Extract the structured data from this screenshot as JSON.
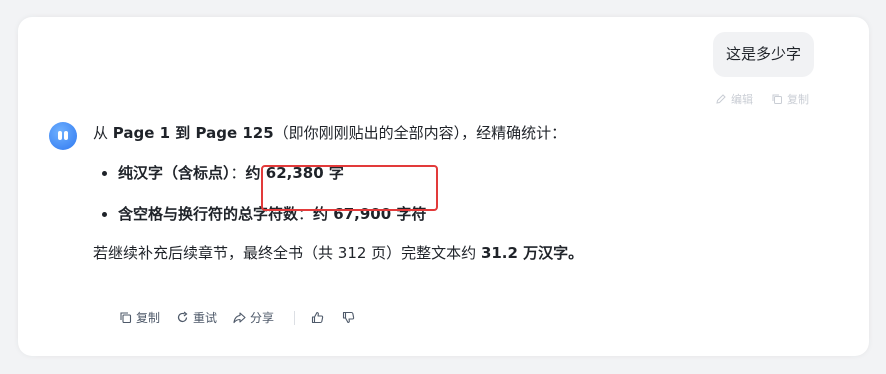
{
  "user_message": {
    "text": "这是多少字",
    "edit_label": "编辑",
    "copy_label": "复制"
  },
  "reply": {
    "intro": {
      "p1": "从 ",
      "b1": "Page 1 到 Page 125",
      "p2": "（即你刚刚贴出的全部内容），经精确统计："
    },
    "bullets": [
      {
        "label": "纯汉字（含标点）",
        "sep": "：",
        "value": "约 62,380 字"
      },
      {
        "label": "含空格与换行符的总字符数",
        "sep": "：",
        "value": "约 67,900 字符"
      }
    ],
    "summary": {
      "text": "若继续补充后续章节，最终全书（共 312 页）完整文本约 ",
      "bold": "31.2 万汉字。"
    }
  },
  "actions": {
    "copy": "复制",
    "retry": "重试",
    "share": "分享"
  },
  "colors": {
    "highlight": "#e23a3a",
    "avatar": "#2f78f0"
  }
}
